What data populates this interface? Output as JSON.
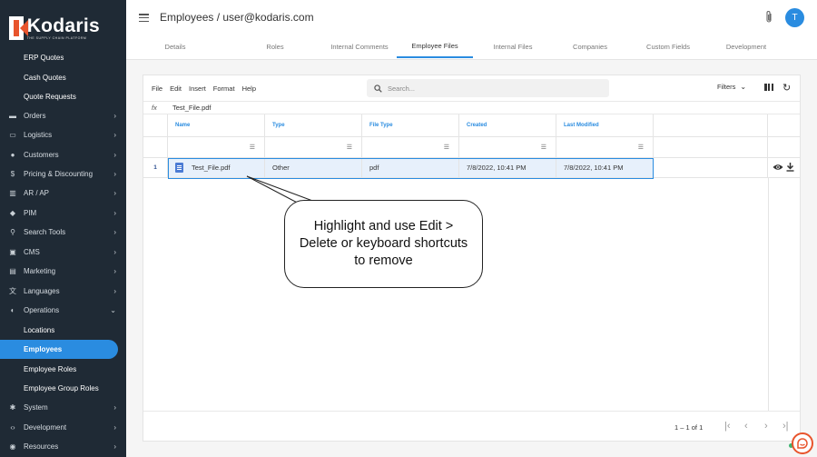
{
  "brand": {
    "name": "Kodaris",
    "tagline": "THE SUPPLY CHAIN PLATFORM"
  },
  "sidebar": {
    "items": [
      {
        "label": "ERP Quotes",
        "icon": "none",
        "sub": true
      },
      {
        "label": "Cash Quotes",
        "icon": "none",
        "sub": true
      },
      {
        "label": "Quote Requests",
        "icon": "none",
        "sub": true
      },
      {
        "label": "Orders",
        "icon": "truck-icon",
        "chevron": "›"
      },
      {
        "label": "Logistics",
        "icon": "logistics-icon",
        "chevron": "›"
      },
      {
        "label": "Customers",
        "icon": "users-icon",
        "chevron": "›"
      },
      {
        "label": "Pricing & Discounting",
        "icon": "dollar-icon",
        "chevron": "›"
      },
      {
        "label": "AR / AP",
        "icon": "bank-icon",
        "chevron": "›"
      },
      {
        "label": "PIM",
        "icon": "tag-icon",
        "chevron": "›"
      },
      {
        "label": "Search Tools",
        "icon": "search-icon",
        "chevron": "›"
      },
      {
        "label": "CMS",
        "icon": "cms-icon",
        "chevron": "›"
      },
      {
        "label": "Marketing",
        "icon": "marketing-icon",
        "chevron": "›"
      },
      {
        "label": "Languages",
        "icon": "translate-icon",
        "chevron": "›"
      },
      {
        "label": "Operations",
        "icon": "operations-icon",
        "chevron": "⌄"
      },
      {
        "label": "Locations",
        "icon": "none",
        "sub": true
      },
      {
        "label": "Employees",
        "icon": "none",
        "sub": true,
        "active": true
      },
      {
        "label": "Employee Roles",
        "icon": "none",
        "sub": true
      },
      {
        "label": "Employee Group Roles",
        "icon": "none",
        "sub": true
      },
      {
        "label": "System",
        "icon": "gear-icon",
        "chevron": "›"
      },
      {
        "label": "Development",
        "icon": "code-icon",
        "chevron": "›"
      },
      {
        "label": "Resources",
        "icon": "resources-icon",
        "chevron": "›"
      }
    ]
  },
  "header": {
    "title": "Employees / user@kodaris.com",
    "avatar_initial": "T",
    "tabs": [
      {
        "label": "Details"
      },
      {
        "label": "Roles"
      },
      {
        "label": "Internal Comments"
      },
      {
        "label": "Employee Files",
        "active": true
      },
      {
        "label": "Internal Files"
      },
      {
        "label": "Companies"
      },
      {
        "label": "Custom Fields"
      },
      {
        "label": "Development"
      }
    ]
  },
  "toolbar": {
    "menu": [
      "File",
      "Edit",
      "Insert",
      "Format",
      "Help"
    ],
    "search_placeholder": "Search...",
    "filters_label": "Filters"
  },
  "formula_bar": {
    "fx": "fx",
    "value": "Test_File.pdf"
  },
  "table": {
    "columns": [
      "Name",
      "Type",
      "File Type",
      "Created",
      "Last Modified"
    ],
    "rows": [
      {
        "num": "1",
        "name": "Test_File.pdf",
        "type": "Other",
        "file_type": "pdf",
        "created": "7/8/2022, 10:41 PM",
        "modified": "7/8/2022, 10:41 PM"
      }
    ]
  },
  "pager": {
    "range": "1 – 1 of 1"
  },
  "callout": {
    "text": "Highlight and use Edit > Delete or keyboard shortcuts to remove"
  },
  "colors": {
    "accent": "#2a8ce0",
    "sidebar": "#1f2a35",
    "brand_orange": "#e8542c"
  }
}
